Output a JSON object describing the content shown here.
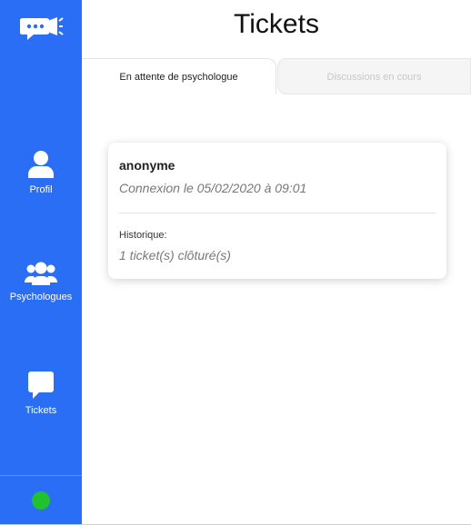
{
  "sidebar": {
    "logo_icon": "megaphone-chat-icon",
    "items": [
      {
        "label": "Profil",
        "icon": "user-icon"
      },
      {
        "label": "Psychologues",
        "icon": "users-icon"
      },
      {
        "label": "Tickets",
        "icon": "chat-bubble-icon"
      }
    ],
    "status": {
      "color": "#22c22f"
    }
  },
  "header": {
    "title": "Tickets"
  },
  "tabs": [
    {
      "label": "En attente de psychologue",
      "active": true
    },
    {
      "label": "Discussions en cours",
      "active": false
    }
  ],
  "tickets": [
    {
      "name": "anonyme",
      "connexion": "Connexion le 05/02/2020 à 09:01",
      "historique_label": "Historique:",
      "historique_value": "1 ticket(s) clôturé(s)"
    }
  ],
  "colors": {
    "sidebar": "#2a6ef5",
    "accent": "#2a6ef5"
  }
}
